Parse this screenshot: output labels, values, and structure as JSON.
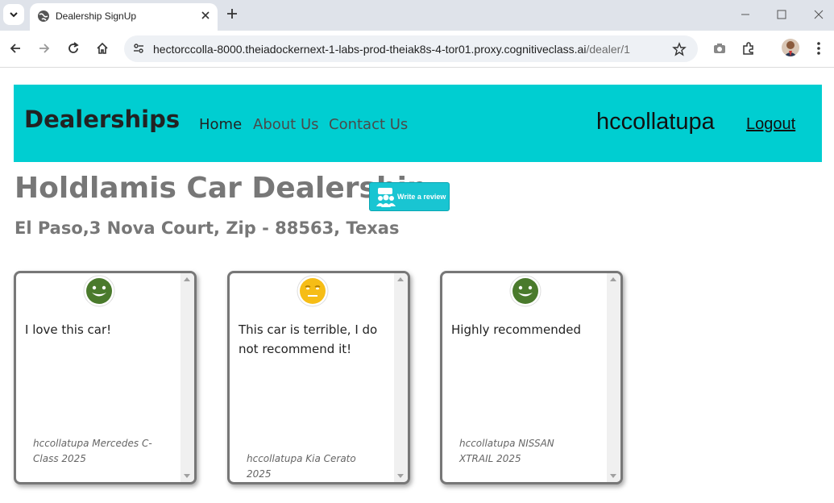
{
  "browser": {
    "tab_title": "Dealership SignUp",
    "url_host": "hectorccolla-8000.theiadockernext-1-labs-prod-theiak8s-4-tor01.proxy.cognitiveclass.ai",
    "url_path": "/dealer/1"
  },
  "navbar": {
    "brand": "Dealerships",
    "links": [
      "Home",
      "About Us",
      "Contact Us"
    ],
    "username": "hccollatupa",
    "logout": "Logout",
    "bg_color": "#00ced1"
  },
  "dealer": {
    "name": "Holdlamis Car Dealership",
    "review_button": "Write a review",
    "address": "El Paso,3 Nova Court, Zip - 88563, Texas"
  },
  "reviews": [
    {
      "sentiment": "positive",
      "icon": "smile-icon",
      "text": "I love this car!",
      "meta": "hccollatupa Mercedes C-Class 2025"
    },
    {
      "sentiment": "neutral",
      "icon": "neutral-face-icon",
      "text": "This car is terrible, I do not recommend it!",
      "meta": "hccollatupa Kia Cerato 2025"
    },
    {
      "sentiment": "positive",
      "icon": "smile-icon",
      "text": "Highly recommended",
      "meta": "hccollatupa NISSAN XTRAIL 2025"
    }
  ]
}
